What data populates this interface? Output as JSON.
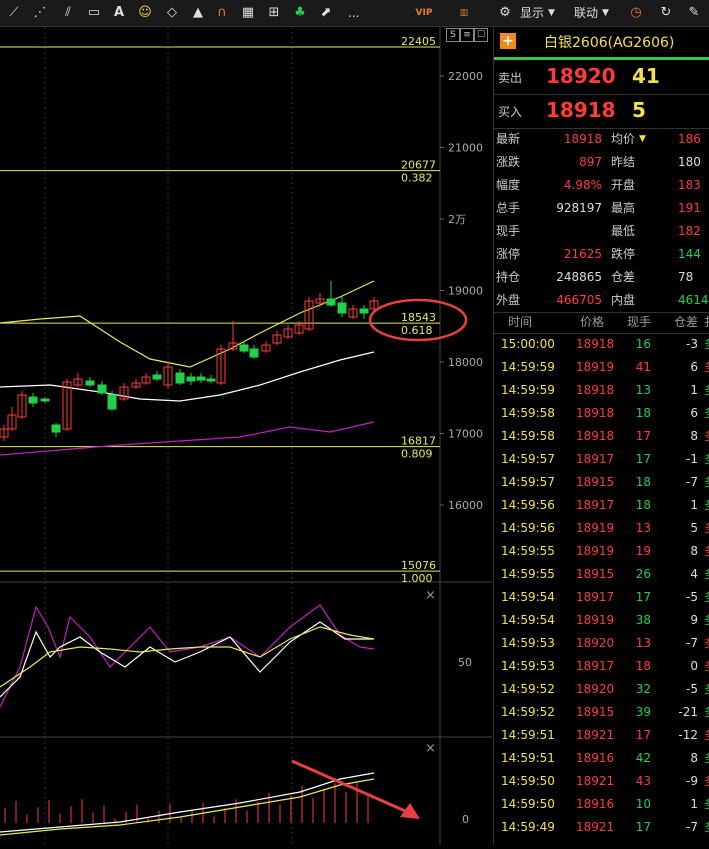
{
  "toolbar": {
    "icons": [
      "line-tool-icon",
      "trend-tool-icon",
      "fan-tool-icon",
      "fib-tool-icon",
      "ruler-icon",
      "text-tool-icon",
      "emoji-icon",
      "eraser-icon",
      "alert-icon",
      "magnet-icon",
      "grid-icon",
      "cross-icon",
      "cluster-icon",
      "export-icon"
    ],
    "text_tool": "A",
    "more": "...",
    "display_label": "显示",
    "link_label": "联动",
    "vip_badge": "VIP"
  },
  "chart": {
    "panel_buttons": [
      "S",
      "≡",
      "☐"
    ],
    "price_ticks": [
      "22000",
      "21000",
      "2万",
      "19000",
      "18000",
      "17000",
      "16000"
    ],
    "fib_levels": [
      {
        "price": "22405",
        "ratio": ""
      },
      {
        "price": "20677",
        "ratio": "0.382"
      },
      {
        "price": "18543",
        "ratio": "0.618"
      },
      {
        "price": "16817",
        "ratio": "0.809"
      },
      {
        "price": "15076",
        "ratio": "1.000"
      }
    ],
    "osc_tick": "50",
    "macd_tick": "0"
  },
  "quote": {
    "name": "白银2606(AG2606)",
    "sell_label": "卖出",
    "sell_price": "18920",
    "sell_vol": "41",
    "buy_label": "买入",
    "buy_price": "18918",
    "buy_vol": "5",
    "stats": [
      {
        "l1": "最新",
        "v1": "18918",
        "c1": "red",
        "l2": "均价",
        "v2": "186",
        "c2": "red",
        "arrow": "▼"
      },
      {
        "l1": "涨跌",
        "v1": "897",
        "c1": "red",
        "l2": "昨结",
        "v2": "180",
        "c2": "white"
      },
      {
        "l1": "幅度",
        "v1": "4.98%",
        "c1": "red",
        "l2": "开盘",
        "v2": "183",
        "c2": "red"
      },
      {
        "l1": "总手",
        "v1": "928197",
        "c1": "white",
        "l2": "最高",
        "v2": "191",
        "c2": "red"
      },
      {
        "l1": "现手",
        "v1": "",
        "c1": "white",
        "l2": "最低",
        "v2": "182",
        "c2": "red"
      },
      {
        "l1": "涨停",
        "v1": "21625",
        "c1": "red",
        "l2": "跌停",
        "v2": "144",
        "c2": "green"
      },
      {
        "l1": "持仓",
        "v1": "248865",
        "c1": "white",
        "l2": "仓差",
        "v2": "78",
        "c2": "white"
      },
      {
        "l1": "外盘",
        "v1": "466705",
        "c1": "red",
        "l2": "内盘",
        "v2": "4614",
        "c2": "green"
      }
    ],
    "tick_headers": [
      "时间",
      "价格",
      "现手",
      "仓差",
      "扌"
    ],
    "ticks": [
      {
        "t": "15:00:00",
        "p": "18918",
        "v": "16",
        "vc": "green",
        "d": "-3"
      },
      {
        "t": "14:59:59",
        "p": "18919",
        "v": "41",
        "vc": "red",
        "d": "6"
      },
      {
        "t": "14:59:59",
        "p": "18918",
        "v": "13",
        "vc": "green",
        "d": "1"
      },
      {
        "t": "14:59:58",
        "p": "18918",
        "v": "18",
        "vc": "green",
        "d": "6"
      },
      {
        "t": "14:59:58",
        "p": "18918",
        "v": "17",
        "vc": "red",
        "d": "8"
      },
      {
        "t": "14:59:57",
        "p": "18917",
        "v": "17",
        "vc": "green",
        "d": "-1"
      },
      {
        "t": "14:59:57",
        "p": "18915",
        "v": "18",
        "vc": "green",
        "d": "-7"
      },
      {
        "t": "14:59:56",
        "p": "18917",
        "v": "18",
        "vc": "green",
        "d": "1"
      },
      {
        "t": "14:59:56",
        "p": "18919",
        "v": "13",
        "vc": "red",
        "d": "5"
      },
      {
        "t": "14:59:55",
        "p": "18919",
        "v": "19",
        "vc": "red",
        "d": "8"
      },
      {
        "t": "14:59:55",
        "p": "18915",
        "v": "26",
        "vc": "green",
        "d": "4"
      },
      {
        "t": "14:59:54",
        "p": "18917",
        "v": "17",
        "vc": "green",
        "d": "-5"
      },
      {
        "t": "14:59:54",
        "p": "18919",
        "v": "38",
        "vc": "green",
        "d": "9"
      },
      {
        "t": "14:59:53",
        "p": "18920",
        "v": "13",
        "vc": "red",
        "d": "-7"
      },
      {
        "t": "14:59:53",
        "p": "18917",
        "v": "18",
        "vc": "red",
        "d": "0"
      },
      {
        "t": "14:59:52",
        "p": "18920",
        "v": "32",
        "vc": "green",
        "d": "-5"
      },
      {
        "t": "14:59:52",
        "p": "18915",
        "v": "39",
        "vc": "green",
        "d": "-21"
      },
      {
        "t": "14:59:51",
        "p": "18921",
        "v": "17",
        "vc": "red",
        "d": "-12"
      },
      {
        "t": "14:59:51",
        "p": "18916",
        "v": "42",
        "vc": "green",
        "d": "8"
      },
      {
        "t": "14:59:50",
        "p": "18921",
        "v": "43",
        "vc": "red",
        "d": "-9"
      },
      {
        "t": "14:59:50",
        "p": "18916",
        "v": "10",
        "vc": "green",
        "d": "1"
      },
      {
        "t": "14:59:49",
        "p": "18921",
        "v": "17",
        "vc": "green",
        "d": "-7"
      }
    ]
  },
  "colors": {
    "up": "#ff3b3b",
    "down": "#22d04a",
    "fib": "#e8e85a",
    "ma_white": "#ffffff",
    "ma_yellow": "#e8e85a",
    "ma_purple": "#c020c0",
    "highlight": "#e84040"
  }
}
